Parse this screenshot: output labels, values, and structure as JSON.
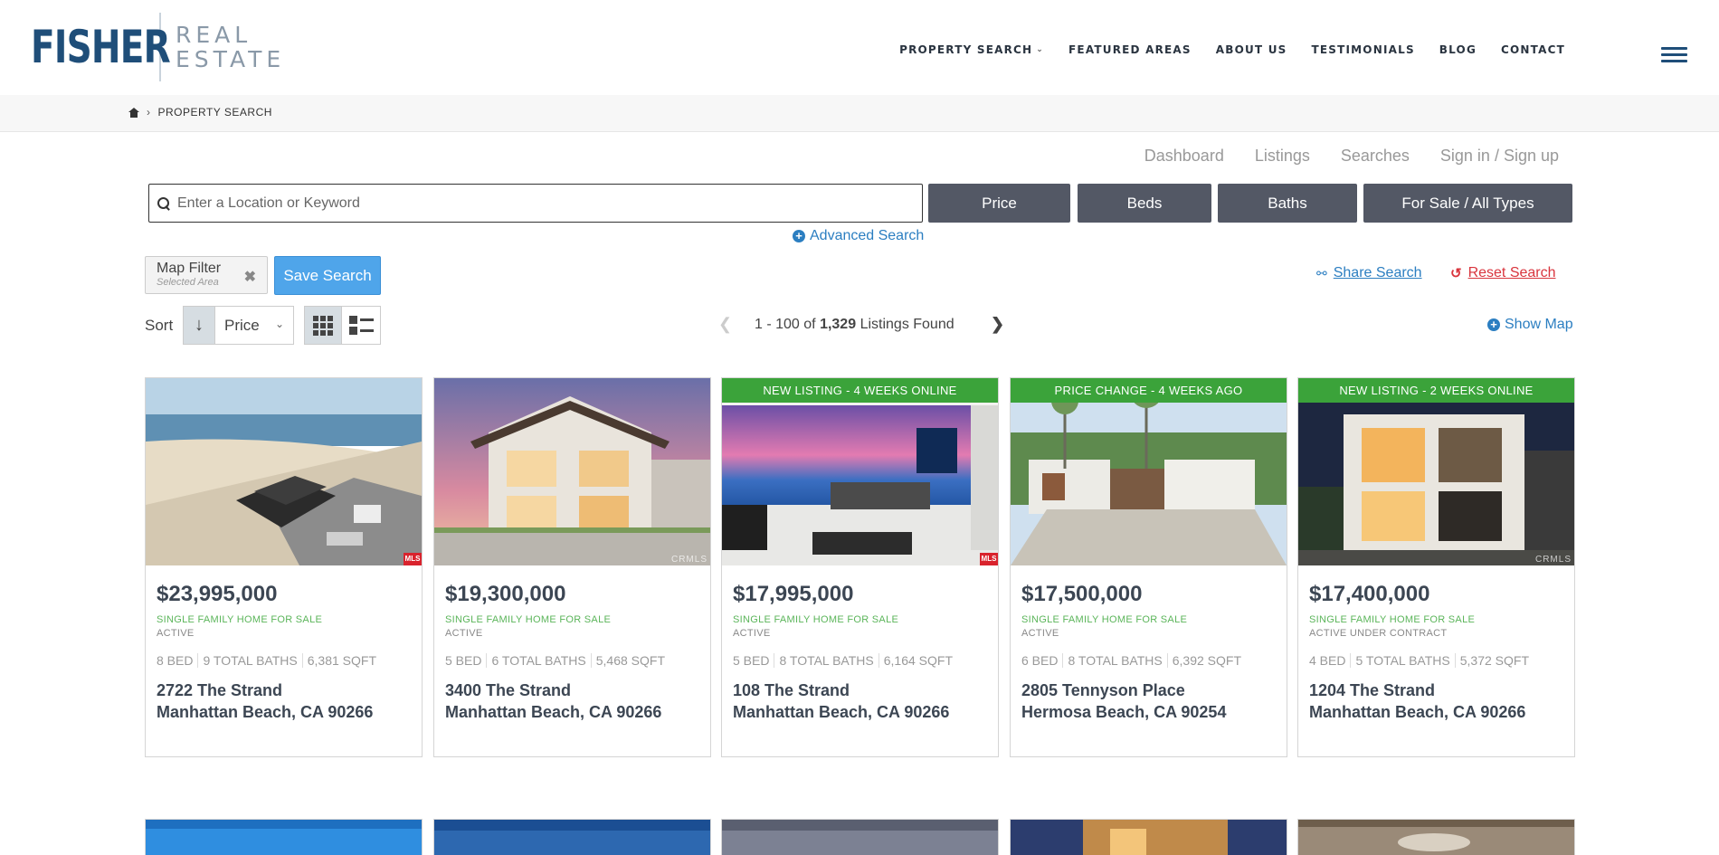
{
  "brand": {
    "main": "FISHER",
    "sub1": "REAL",
    "sub2": "ESTATE"
  },
  "nav": {
    "items": [
      "PROPERTY SEARCH",
      "FEATURED AREAS",
      "ABOUT US",
      "TESTIMONIALS",
      "BLOG",
      "CONTACT"
    ]
  },
  "breadcrumb": {
    "current": "PROPERTY SEARCH"
  },
  "user_links": [
    "Dashboard",
    "Listings",
    "Searches",
    "Sign in / Sign up"
  ],
  "search": {
    "placeholder": "Enter a Location or Keyword",
    "value": ""
  },
  "filters": [
    "Price",
    "Beds",
    "Baths",
    "For Sale / All Types"
  ],
  "advanced_search": "Advanced Search",
  "map_filter": {
    "title": "Map Filter",
    "subtitle": "Selected Area"
  },
  "save_search": "Save Search",
  "share_search": "Share Search",
  "reset_search": "Reset Search",
  "sort": {
    "label": "Sort",
    "field": "Price"
  },
  "pager": {
    "range": "1 - 100 of",
    "total": "1,329",
    "suffix": "Listings Found"
  },
  "show_map": "Show Map",
  "colors": {
    "brand": "#1f4e79",
    "accent": "#2b7ec1",
    "banner": "#3ba33a",
    "danger": "#d9343d",
    "button": "#535865"
  },
  "listings": [
    {
      "banner": "",
      "price": "$23,995,000",
      "type": "SINGLE FAMILY HOME FOR SALE",
      "status": "ACTIVE",
      "beds": "8 BED",
      "baths": "9 TOTAL BATHS",
      "sqft": "6,381 SQFT",
      "street": "2722 The Strand",
      "city": "Manhattan Beach, CA 90266"
    },
    {
      "banner": "",
      "price": "$19,300,000",
      "type": "SINGLE FAMILY HOME FOR SALE",
      "status": "ACTIVE",
      "beds": "5 BED",
      "baths": "6 TOTAL BATHS",
      "sqft": "5,468 SQFT",
      "street": "3400 The Strand",
      "city": "Manhattan Beach, CA 90266"
    },
    {
      "banner": "NEW LISTING - 4 WEEKS ONLINE",
      "price": "$17,995,000",
      "type": "SINGLE FAMILY HOME FOR SALE",
      "status": "ACTIVE",
      "beds": "5 BED",
      "baths": "8 TOTAL BATHS",
      "sqft": "6,164 SQFT",
      "street": "108 The Strand",
      "city": "Manhattan Beach, CA 90266"
    },
    {
      "banner": "PRICE CHANGE - 4 WEEKS AGO",
      "price": "$17,500,000",
      "type": "SINGLE FAMILY HOME FOR SALE",
      "status": "ACTIVE",
      "beds": "6 BED",
      "baths": "8 TOTAL BATHS",
      "sqft": "6,392 SQFT",
      "street": "2805 Tennyson Place",
      "city": "Hermosa Beach, CA 90254"
    },
    {
      "banner": "NEW LISTING - 2 WEEKS ONLINE",
      "price": "$17,400,000",
      "type": "SINGLE FAMILY HOME FOR SALE",
      "status": "ACTIVE UNDER CONTRACT",
      "beds": "4 BED",
      "baths": "5 TOTAL BATHS",
      "sqft": "5,372 SQFT",
      "street": "1204 The Strand",
      "city": "Manhattan Beach, CA 90266"
    }
  ]
}
